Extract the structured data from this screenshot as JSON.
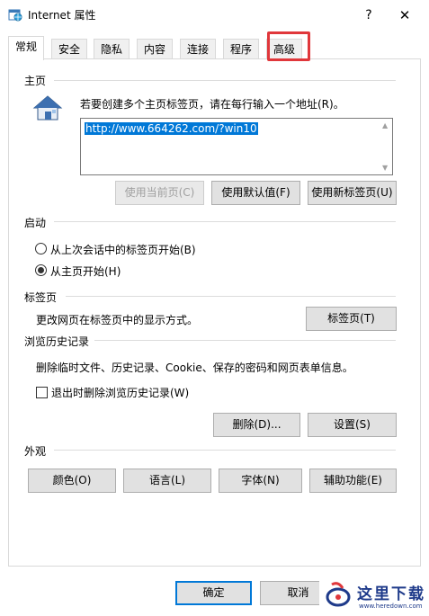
{
  "window": {
    "title": "Internet 属性",
    "help_glyph": "?",
    "close_glyph": "✕",
    "icon": "internet-options-icon"
  },
  "tabs": [
    {
      "label": "常规",
      "active": true
    },
    {
      "label": "安全",
      "active": false
    },
    {
      "label": "隐私",
      "active": false
    },
    {
      "label": "内容",
      "active": false
    },
    {
      "label": "连接",
      "active": false
    },
    {
      "label": "程序",
      "active": false
    },
    {
      "label": "高级",
      "active": false,
      "highlighted": true
    }
  ],
  "highlight_color": "#e0373b",
  "homepage": {
    "title": "主页",
    "hint": "若要创建多个主页标签页，请在每行输入一个地址(R)。",
    "url": "http://www.664262.com/?win10",
    "buttons": {
      "use_current": "使用当前页(C)",
      "use_default": "使用默认值(F)",
      "use_new_tab": "使用新标签页(U)"
    }
  },
  "startup": {
    "title": "启动",
    "options": [
      {
        "label": "从上次会话中的标签页开始(B)",
        "checked": false
      },
      {
        "label": "从主页开始(H)",
        "checked": true
      }
    ]
  },
  "tabs_section": {
    "title": "标签页",
    "hint": "更改网页在标签页中的显示方式。",
    "button": "标签页(T)"
  },
  "history": {
    "title": "浏览历史记录",
    "hint": "删除临时文件、历史记录、Cookie、保存的密码和网页表单信息。",
    "checkbox_label": "退出时删除浏览历史记录(W)",
    "checkbox_checked": false,
    "delete_button": "删除(D)...",
    "settings_button": "设置(S)"
  },
  "appearance": {
    "title": "外观",
    "buttons": [
      "颜色(O)",
      "语言(L)",
      "字体(N)",
      "辅助功能(E)"
    ]
  },
  "footer": {
    "ok": "确定",
    "cancel": "取消"
  },
  "watermark": {
    "text": "这里下载",
    "sub": "www.heredown.com"
  },
  "accent_color": "#0078d7"
}
